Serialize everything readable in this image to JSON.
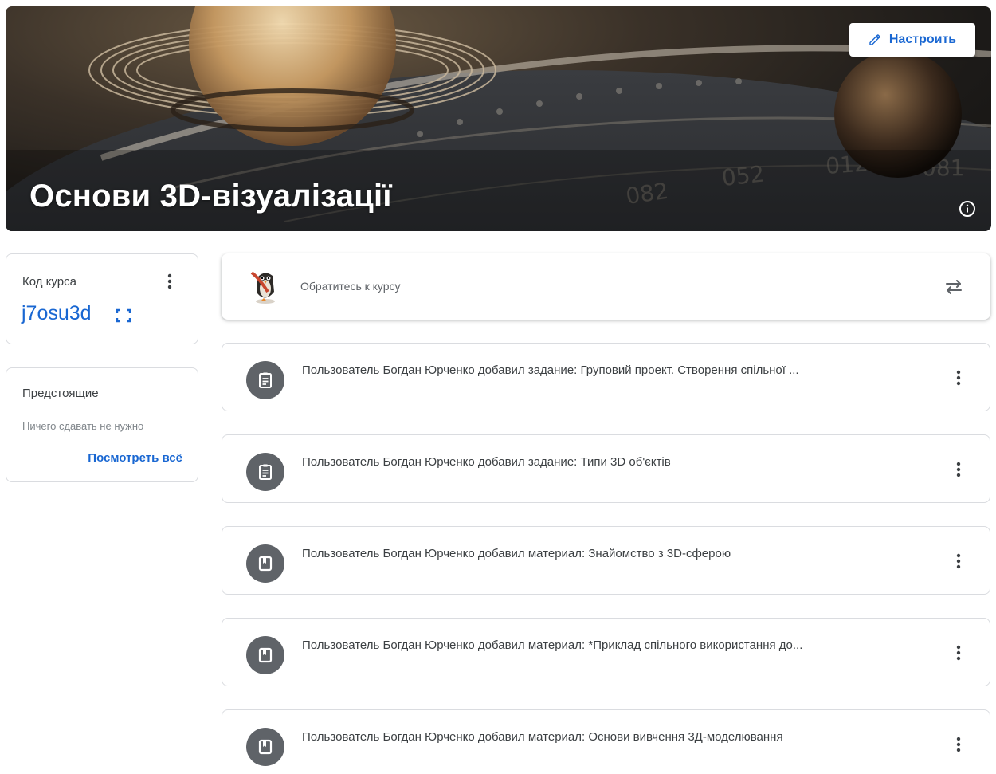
{
  "banner": {
    "title": "Основи 3D-візуалізації",
    "customize_label": "Настроить"
  },
  "class_code": {
    "title": "Код курса",
    "value": "j7osu3d"
  },
  "upcoming": {
    "title": "Предстоящие",
    "empty_text": "Ничего сдавать не нужно",
    "view_all": "Посмотреть всё"
  },
  "announce": {
    "placeholder": "Обратитесь к курсу"
  },
  "posts": [
    {
      "type": "assignment",
      "icon": "assignment-icon",
      "text": "Пользователь Богдан Юрченко добавил задание: Груповий проект. Створення спільної ..."
    },
    {
      "type": "assignment",
      "icon": "assignment-icon",
      "text": "Пользователь Богдан Юрченко добавил задание: Типи 3D об'єктів"
    },
    {
      "type": "material",
      "icon": "material-icon",
      "text": "Пользователь Богдан Юрченко добавил материал: Знайомство з 3D-сферою"
    },
    {
      "type": "material",
      "icon": "material-icon",
      "text": "Пользователь Богдан Юрченко добавил материал: *Приклад спільного використання до..."
    },
    {
      "type": "material",
      "icon": "material-icon",
      "text": "Пользователь Богдан Юрченко добавил материал: Основи вивчення 3Д-моделювання"
    }
  ],
  "colors": {
    "accent": "#1967d2",
    "icon_circle": "#5f6368",
    "border": "#dadce0",
    "banner_dark": "#1c1a18"
  }
}
